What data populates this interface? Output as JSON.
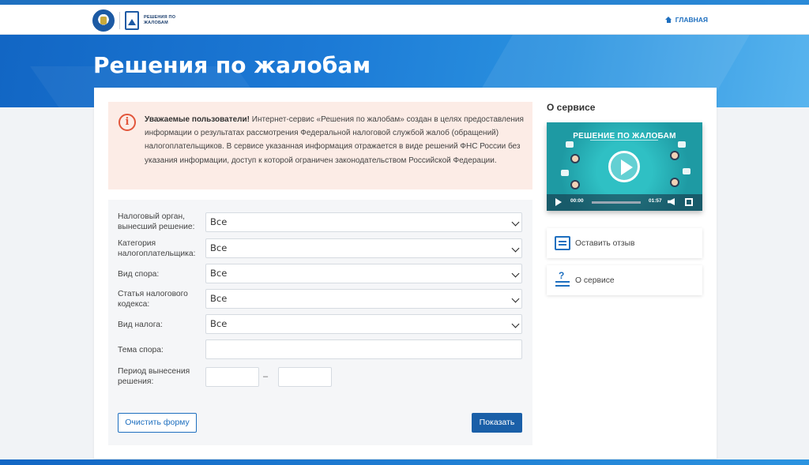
{
  "header": {
    "logo_text": "РЕШЕНИЯ ПО ЖАЛОБАМ",
    "nav_home_label": "ГЛАВНАЯ"
  },
  "page": {
    "title": "Решения по жалобам"
  },
  "notice": {
    "icon": "info-icon",
    "bold": "Уважаемые пользователи!",
    "text": " Интернет-сервис «Решения по жалобам» создан в целях предоставления информации о результатах рассмотрения Федеральной налоговой службой жалоб (обращений) налогоплательщиков. В сервисе указанная информация отражается в виде решений ФНС России без указания информации, доступ к которой ограничен законодательством Российской Федерации."
  },
  "form": {
    "fields": [
      {
        "label": "Налоговый орган, вынесший решение:",
        "value": "Все"
      },
      {
        "label": "Категория налогоплательщика:",
        "value": "Все"
      },
      {
        "label": "Вид спора:",
        "value": "Все"
      },
      {
        "label": "Статья налогового кодекса:",
        "value": "Все"
      },
      {
        "label": "Вид налога:",
        "value": "Все"
      }
    ],
    "topic_label": "Тема спора:",
    "topic_value": "",
    "period_label": "Период вынесения решения:",
    "period_from": "",
    "period_to": "",
    "period_dash": "–",
    "clear_label": "Очистить форму",
    "submit_label": "Показать"
  },
  "sidebar": {
    "title": "О сервисе",
    "video": {
      "title": "РЕШЕНИЕ ПО ЖАЛОБАМ",
      "time_current": "00:00",
      "time_total": "01:57",
      "progress": 0
    },
    "buttons": [
      {
        "label": "Оставить отзыв",
        "icon": "feedback-icon"
      },
      {
        "label": "О сервисе",
        "icon": "about-icon"
      }
    ]
  },
  "colors": {
    "brand_blue": "#1e6fbf",
    "submit_bg": "#1a5fa8",
    "notice_bg": "#fcece6",
    "notice_icon": "#e2563b"
  }
}
